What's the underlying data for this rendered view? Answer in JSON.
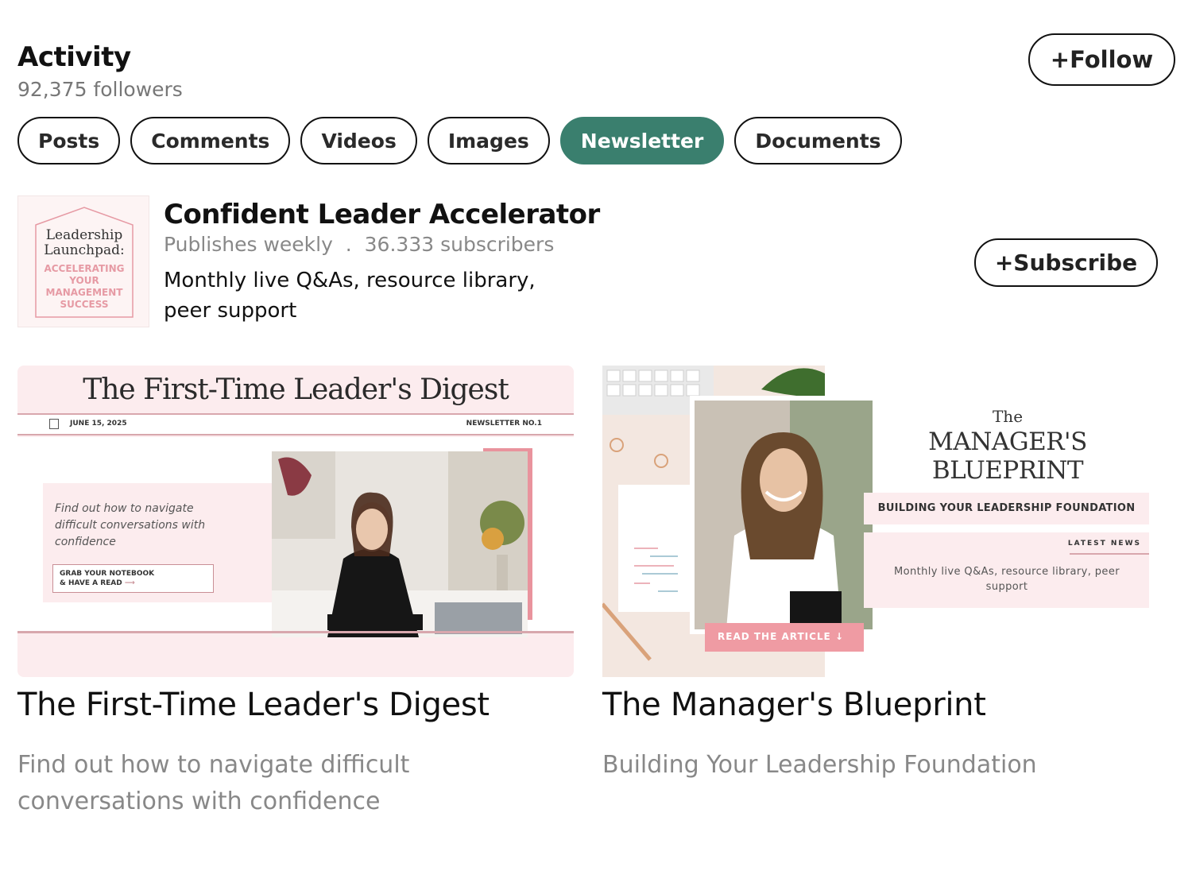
{
  "header": {
    "title": "Activity",
    "followers": "92,375 followers",
    "follow_label": "+Follow"
  },
  "tabs": [
    {
      "label": "Posts",
      "active": false
    },
    {
      "label": "Comments",
      "active": false
    },
    {
      "label": "Videos",
      "active": false
    },
    {
      "label": "Images",
      "active": false
    },
    {
      "label": "Newsletter",
      "active": true
    },
    {
      "label": "Documents",
      "active": false
    }
  ],
  "newsletter": {
    "logo_line1": "Leadership",
    "logo_line2": "Launchpad:",
    "logo_tag1": "ACCELERATING",
    "logo_tag2": "YOUR",
    "logo_tag3": "MANAGEMENT",
    "logo_tag4": "SUCCESS",
    "name": "Confident Leader Accelerator",
    "frequency": "Publishes weekly",
    "separator": ".",
    "subscribers": "36.333 subscribers",
    "description": "Monthly live Q&As, resource library, peer support",
    "subscribe_label": "+Subscribe"
  },
  "articles": [
    {
      "cover_title": "The First-Time Leader's Digest",
      "cover_date": "JUNE 15, 2025",
      "cover_issue": "NEWSLETTER NO.1",
      "cover_blurb": "Find out how to navigate difficult conversations with confidence",
      "cover_cta_line1": "GRAB YOUR NOTEBOOK",
      "cover_cta_line2": "& HAVE A READ",
      "title": "The First-Time Leader's Digest",
      "subtitle": "Find out how to navigate difficult conversations with confidence"
    },
    {
      "cover_the": "The",
      "cover_title_line1": "MANAGER'S",
      "cover_title_line2": "BLUEPRINT",
      "cover_band": "BUILDING YOUR LEADERSHIP FOUNDATION",
      "cover_latest": "LATEST NEWS",
      "cover_blurb": "Monthly live Q&As, resource library, peer support",
      "cover_cta": "READ THE ARTICLE",
      "title": "The Manager's Blueprint",
      "subtitle": "Building Your Leadership Foundation"
    }
  ],
  "colors": {
    "accent_green": "#3a7f6e",
    "cover_pink": "#fcecee",
    "cta_pink": "#ef9ba3"
  }
}
